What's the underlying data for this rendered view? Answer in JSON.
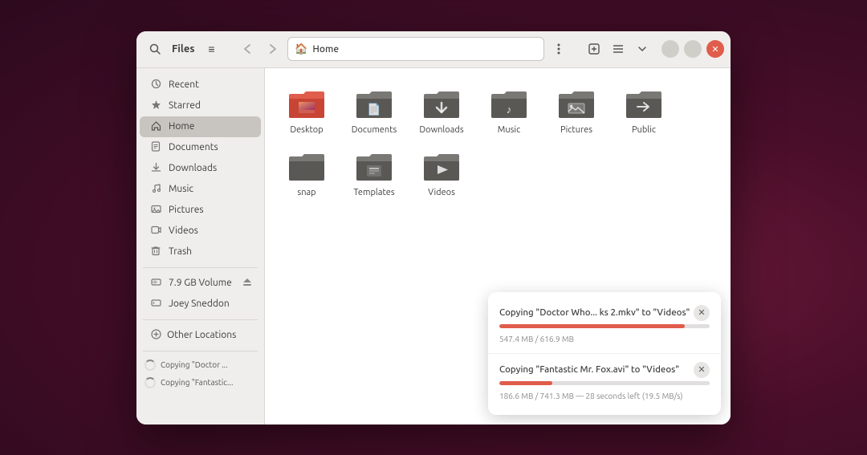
{
  "window": {
    "title": "Files"
  },
  "titlebar": {
    "search_label": "🔍",
    "hamburger_label": "≡",
    "back_label": "‹",
    "forward_label": "›",
    "location": "Home",
    "home_icon": "🏠",
    "kebab_label": "⋮",
    "new_tab_icon": "⊞",
    "view_icon": "≡",
    "sort_icon": "⌄",
    "minimize_label": "–",
    "maximize_label": "□",
    "close_label": "✕"
  },
  "sidebar": {
    "items": [
      {
        "id": "recent",
        "label": "Recent",
        "icon": "🕐"
      },
      {
        "id": "starred",
        "label": "Starred",
        "icon": "★"
      },
      {
        "id": "home",
        "label": "Home",
        "icon": "🏠",
        "active": true
      },
      {
        "id": "documents",
        "label": "Documents",
        "icon": "📄"
      },
      {
        "id": "downloads",
        "label": "Downloads",
        "icon": "⬇"
      },
      {
        "id": "music",
        "label": "Music",
        "icon": "♪"
      },
      {
        "id": "pictures",
        "label": "Pictures",
        "icon": "🖼"
      },
      {
        "id": "videos",
        "label": "Videos",
        "icon": "🎬"
      },
      {
        "id": "trash",
        "label": "Trash",
        "icon": "🗑"
      }
    ],
    "volume": {
      "label": "7.9 GB Volume",
      "icon": "💾"
    },
    "user": {
      "label": "Joey Sneddon",
      "icon": "💾"
    },
    "other_locations": {
      "label": "Other Locations",
      "icon": "+"
    },
    "copy_status1": "Copying \"Doctor ...",
    "copy_status2": "Copying \"Fantastic..."
  },
  "files": [
    {
      "id": "desktop",
      "label": "Desktop",
      "color": "#e05c4b",
      "accent": "#c84434",
      "icon_type": "gradient"
    },
    {
      "id": "documents",
      "label": "Documents",
      "color": "#6e6d6b",
      "accent": "#555",
      "icon_type": "plain"
    },
    {
      "id": "downloads",
      "label": "Downloads",
      "color": "#6e6d6b",
      "accent": "#555",
      "icon_type": "plain"
    },
    {
      "id": "music",
      "label": "Music",
      "color": "#6e6d6b",
      "accent": "#555",
      "icon_type": "plain"
    },
    {
      "id": "pictures",
      "label": "Pictures",
      "color": "#6e6d6b",
      "accent": "#555",
      "icon_type": "plain"
    },
    {
      "id": "public",
      "label": "Public",
      "color": "#6e6d6b",
      "accent": "#555",
      "icon_type": "plain"
    },
    {
      "id": "snap",
      "label": "snap",
      "color": "#6e6d6b",
      "accent": "#555",
      "icon_type": "plain"
    },
    {
      "id": "templates",
      "label": "Templates",
      "color": "#6e6d6b",
      "accent": "#555",
      "icon_type": "plain"
    },
    {
      "id": "videos",
      "label": "Videos",
      "color": "#6e6d6b",
      "accent": "#555",
      "icon_type": "plain"
    }
  ],
  "folder_icons": {
    "desktop": {
      "top_color": "#e8524a",
      "bottom_color": "#c8423a"
    },
    "documents": {
      "top_color": "#7a7875",
      "bottom_color": "#5a5855",
      "badge_icon": "📄"
    },
    "downloads": {
      "top_color": "#7a7875",
      "bottom_color": "#5a5855",
      "badge_icon": "⬇"
    },
    "music": {
      "top_color": "#7a7875",
      "bottom_color": "#5a5855",
      "badge_icon": "♪"
    },
    "pictures": {
      "top_color": "#7a7875",
      "bottom_color": "#5a5855",
      "badge_icon": "🖼"
    },
    "public": {
      "top_color": "#7a7875",
      "bottom_color": "#5a5855",
      "badge_icon": "🔗"
    },
    "snap": {
      "top_color": "#7a7875",
      "bottom_color": "#5a5855",
      "badge_icon": ""
    },
    "templates": {
      "top_color": "#7a7875",
      "bottom_color": "#5a5855",
      "badge_icon": "📋"
    },
    "videos": {
      "top_color": "#7a7875",
      "bottom_color": "#5a5855",
      "badge_icon": "▶"
    }
  },
  "progress": {
    "items": [
      {
        "title": "Copying \"Doctor Who... ks 2.mkv\" to \"Videos\"",
        "sub": "547.4 MB / 616.9 MB",
        "percent": 88
      },
      {
        "title": "Copying \"Fantastic Mr. Fox.avi\" to \"Videos\"",
        "sub": "186.6 MB / 741.3 MB — 28 seconds left (19.5 MB/s)",
        "percent": 25
      }
    ]
  }
}
